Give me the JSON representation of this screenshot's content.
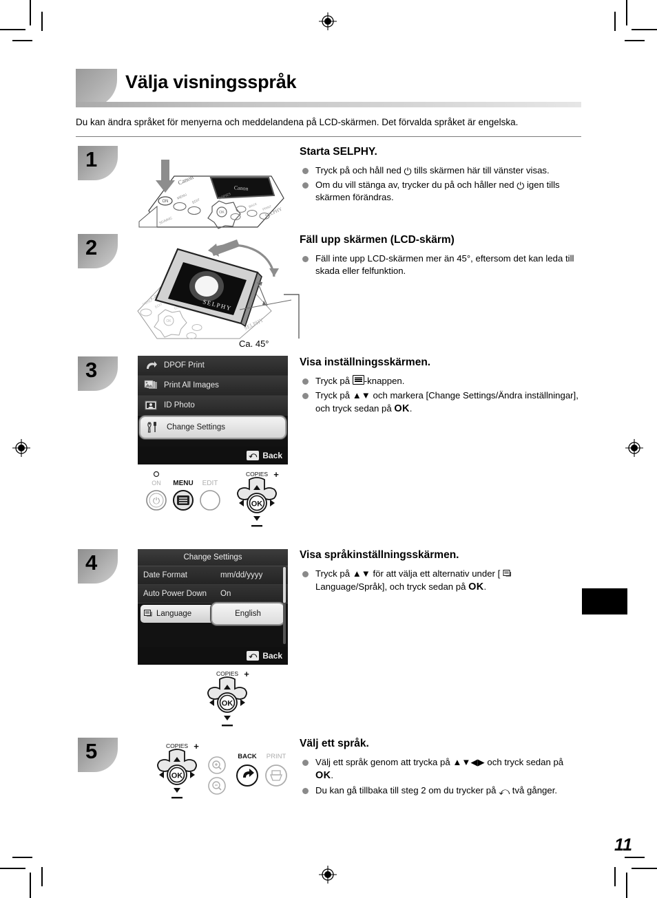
{
  "document": {
    "title": "Välja visningsspråk",
    "intro": "Du kan ändra språket för menyerna och meddelandena på LCD-skärmen. Det förvalda språket är engelska.",
    "page_number": "11",
    "angle_caption": "Ca. 45°"
  },
  "steps": [
    {
      "number": "1",
      "title": "Starta SELPHY.",
      "bullets": [
        {
          "pre": "Tryck på och håll ned ",
          "icon": "power-icon",
          "post": " tills skärmen här till vänster visas."
        },
        {
          "pre": "Om du vill stänga av, trycker du på och håller ned ",
          "icon": "power-icon",
          "post": " igen tills skärmen förändras."
        }
      ]
    },
    {
      "number": "2",
      "title": "Fäll upp skärmen (LCD-skärm)",
      "bullets": [
        {
          "pre": "Fäll inte upp LCD-skärmen mer än 45°, eftersom det kan leda till skada eller felfunktion.",
          "icon": "",
          "post": ""
        }
      ]
    },
    {
      "number": "3",
      "title": "Visa inställningsskärmen.",
      "bullets": [
        {
          "pre": "Tryck på ",
          "icon": "menu-icon",
          "post": "-knappen."
        },
        {
          "pre": "Tryck på ",
          "icon": "up-down-arrows",
          "post": " och markera [Change Settings/Ändra inställningar], och tryck sedan på ",
          "ok": "OK",
          "tail": "."
        }
      ]
    },
    {
      "number": "4",
      "title": "Visa språkinställningsskärmen.",
      "bullets": [
        {
          "pre": "Tryck på ",
          "icon": "up-down-arrows",
          "post": " för att välja ett alternativ under [ ",
          "icon2": "language-icon",
          "post2": " Language/Språk], och tryck sedan på ",
          "ok": "OK",
          "tail": "."
        }
      ]
    },
    {
      "number": "5",
      "title": "Välj ett språk.",
      "bullets": [
        {
          "pre": "Välj ett språk genom att trycka på ",
          "icon": "four-way-arrows",
          "post": " och tryck sedan på ",
          "ok": "OK",
          "tail": "."
        },
        {
          "pre": "Du kan gå tillbaka till steg 2 om du trycker på ",
          "icon": "back-icon",
          "post": " två gånger."
        }
      ]
    }
  ],
  "lcd_menu_screen": {
    "items": [
      {
        "icon": "dpof-icon",
        "label": "DPOF Print",
        "selected": false
      },
      {
        "icon": "images-icon",
        "label": "Print All Images",
        "selected": false
      },
      {
        "icon": "id-photo-icon",
        "label": "ID Photo",
        "selected": false
      },
      {
        "icon": "tools-icon",
        "label": "Change Settings",
        "selected": true
      }
    ],
    "footer_label": "Back",
    "footer_icon": "back-arrow-icon"
  },
  "lcd_settings_screen": {
    "title": "Change Settings",
    "rows": [
      {
        "icon": "",
        "label": "Date Format",
        "value": "mm/dd/yyyy",
        "selected": false
      },
      {
        "icon": "",
        "label": "Auto Power Down",
        "value": "On",
        "selected": false
      },
      {
        "icon": "language-icon",
        "label": "Language",
        "value": "English",
        "selected": true
      }
    ],
    "footer_label": "Back",
    "footer_icon": "back-arrow-icon"
  },
  "control_panel_step3": {
    "buttons": [
      {
        "name": "on-button",
        "label": "ON",
        "icon": "power-icon",
        "dim": true
      },
      {
        "name": "menu-button",
        "label": "MENU",
        "icon": "menu-icon",
        "dim": false
      },
      {
        "name": "edit-button",
        "label": "EDIT",
        "icon": "",
        "dim": true
      }
    ],
    "dpad": {
      "top_label": "COPIES",
      "plus": "+",
      "minus": "–",
      "center": "OK"
    }
  },
  "control_panel_step5": {
    "dpad": {
      "top_label": "COPIES",
      "plus": "+",
      "minus": "–",
      "center": "OK"
    },
    "buttons": [
      {
        "name": "zoom-in-button",
        "label": "",
        "icon": "magnify-plus-icon",
        "dim": true
      },
      {
        "name": "zoom-out-button",
        "label": "",
        "icon": "magnify-minus-icon",
        "dim": true
      },
      {
        "name": "back-button",
        "label": "BACK",
        "icon": "back-arrow-icon",
        "dim": false
      },
      {
        "name": "print-button",
        "label": "PRINT",
        "icon": "printer-icon",
        "dim": true
      }
    ]
  },
  "printer_illustration": {
    "brand": "Canon",
    "model_text": "SELPHY",
    "screen_text": "SELPHY"
  },
  "colors": {
    "header_band": "#a9a9a9",
    "badge": "#a5a5a5",
    "bullet": "#8a8a8a",
    "lcd_background": "#121212",
    "selection_highlight": "#e6e6e6"
  }
}
